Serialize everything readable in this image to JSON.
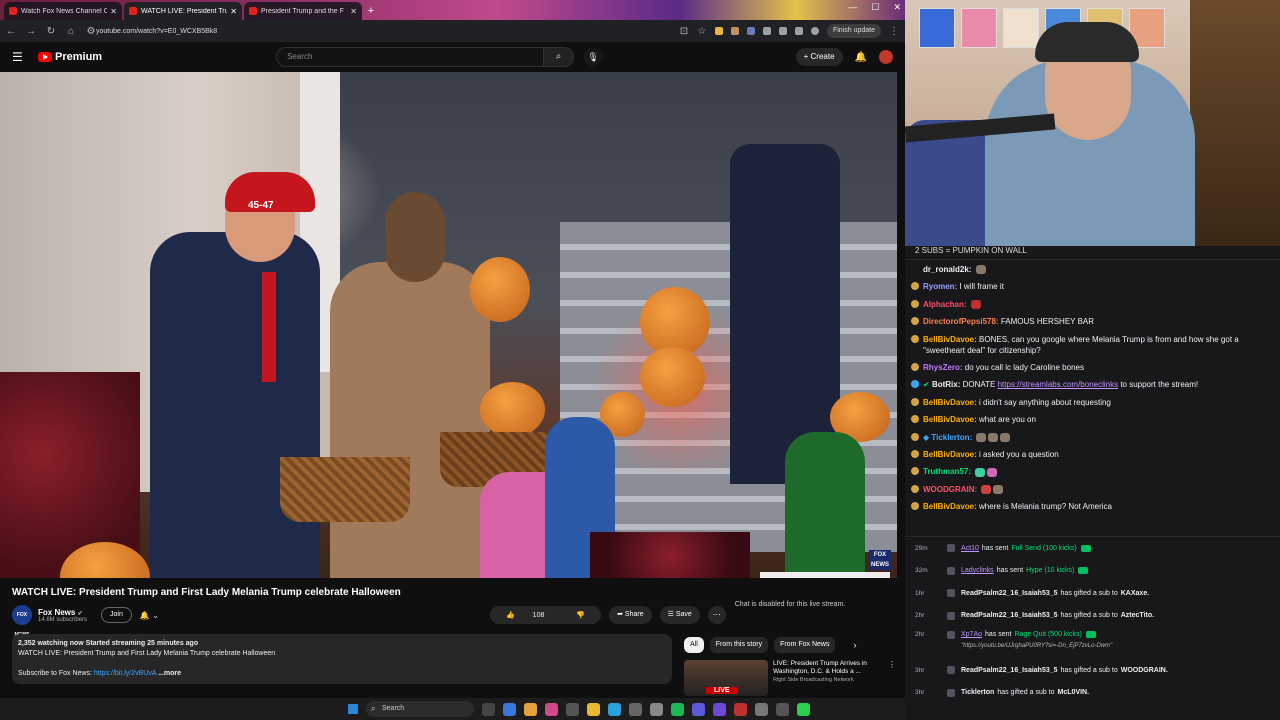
{
  "browser": {
    "tabs": [
      {
        "title": "Watch Fox News Channel O"
      },
      {
        "title": "WATCH LIVE: President Tru"
      },
      {
        "title": "President Trump and the F"
      }
    ],
    "url": "youtube.com/watch?v=E0_WCXB5Bk8",
    "finish_update": "Finish update"
  },
  "youtube": {
    "logo_text": "Premium",
    "search_placeholder": "Search",
    "create_label": "Create",
    "video_bug": "FOX NEWS",
    "hat_text": "45-47",
    "video_title": "WATCH LIVE: President Trump and First Lady Melania Trump celebrate Halloween",
    "channel": {
      "name": "Fox News",
      "subs": "14.6M subscribers",
      "avatar_text": "FOX NEWS"
    },
    "join_label": "Join",
    "like_count": "108",
    "share_label": "Share",
    "save_label": "Save",
    "chat_disabled": "Chat is disabled for this live stream.",
    "description": {
      "stats": "2,352 watching now  Started streaming 25 minutes ago",
      "line2": "WATCH LIVE: President Trump and First Lady Melania Trump celebrate Halloween",
      "subscribe_prefix": "Subscribe to Fox News: ",
      "subscribe_link": "https://bit.ly/2vBUvA",
      "more": "...more"
    },
    "chips": [
      "All",
      "From this story",
      "From Fox News"
    ],
    "related": {
      "title": "LIVE: President Trump Arrives in Washington, D.C. & Holds a ...",
      "channel": "Right Side Broadcasting Network",
      "badge": "LIVE"
    }
  },
  "taskbar": {
    "search_placeholder": "Search"
  },
  "chat": {
    "pinned": "2 SUBS = PUMPKIN ON WALL",
    "messages": [
      {
        "user": "dr_ronald2k:",
        "text": "",
        "color": "#efeff1"
      },
      {
        "user": "Ryomen:",
        "text": "I will frame it",
        "color": "#9aa0ff"
      },
      {
        "user": "Alphachan:",
        "text": "",
        "color": "#ff4f6a"
      },
      {
        "user": "DirectorofPepsi578:",
        "text": "FAMOUS HERSHEY BAR",
        "color": "#ff7f50"
      },
      {
        "user": "BellBivDavoe:",
        "text": "BONES, can you google where Melania Trump is from and how she got a \"sweetheart deal\" for citizenship?",
        "color": "#ffb000"
      },
      {
        "user": "RhysZero:",
        "text": "do you call lc lady Caroline bones",
        "color": "#c07aff"
      },
      {
        "user": "BotRix:",
        "text": "DONATE ",
        "link": "https://streamlabs.com/boneclinks",
        "text2": " to support the stream!",
        "color": "#efeff1"
      },
      {
        "user": "BellBivDavoe:",
        "text": "i didn't say anything about requesting",
        "color": "#ffb000"
      },
      {
        "user": "BellBivDavoe:",
        "text": "what are you on",
        "color": "#ffb000"
      },
      {
        "user": "Ticklerton:",
        "text": "",
        "color": "#3ea6ff"
      },
      {
        "user": "BellBivDavoe:",
        "text": "i asked you a question",
        "color": "#ffb000"
      },
      {
        "user": "Truthman57:",
        "text": "",
        "color": "#00e07a"
      },
      {
        "user": "WOODGRAIN:",
        "text": "",
        "color": "#ff4f6a"
      },
      {
        "user": "BellBivDavoe:",
        "text": "where is Melania trump? Not America",
        "color": "#ffb000"
      }
    ],
    "events": [
      {
        "time": "29m",
        "name": "Act10",
        "mid": "has sent",
        "highlight": "Full Send (100 kicks)",
        "kick": true
      },
      {
        "time": "32m",
        "name": "Ladyclinks",
        "mid": "has sent",
        "highlight": "Hype (10 kicks)",
        "kick": true
      },
      {
        "time": "1hr",
        "name": "ReadPsalm22_16_Isaiah53_5",
        "mid": "has gifted a sub to",
        "bold": "KAXaxe."
      },
      {
        "time": "2hr",
        "name": "ReadPsalm22_16_Isaiah53_5",
        "mid": "has gifted a sub to",
        "bold": "AztecTito."
      },
      {
        "time": "2hr",
        "name": "Xp7Ao",
        "mid": "has sent",
        "highlight": "Rage Quit (500 kicks)",
        "kick": true,
        "sub": "\"https://youtu.be/UJrghaPU0RY?si=-Dn_EjP7zvLo-Dwm\""
      },
      {
        "time": "3hr",
        "name": "ReadPsalm22_16_Isaiah53_5",
        "mid": "has gifted a sub to",
        "bold": "WOODGRAIN."
      },
      {
        "time": "3hr",
        "name": "Ticklerton",
        "mid": "has gifted a sub to",
        "bold": "McL0VIN."
      }
    ]
  }
}
